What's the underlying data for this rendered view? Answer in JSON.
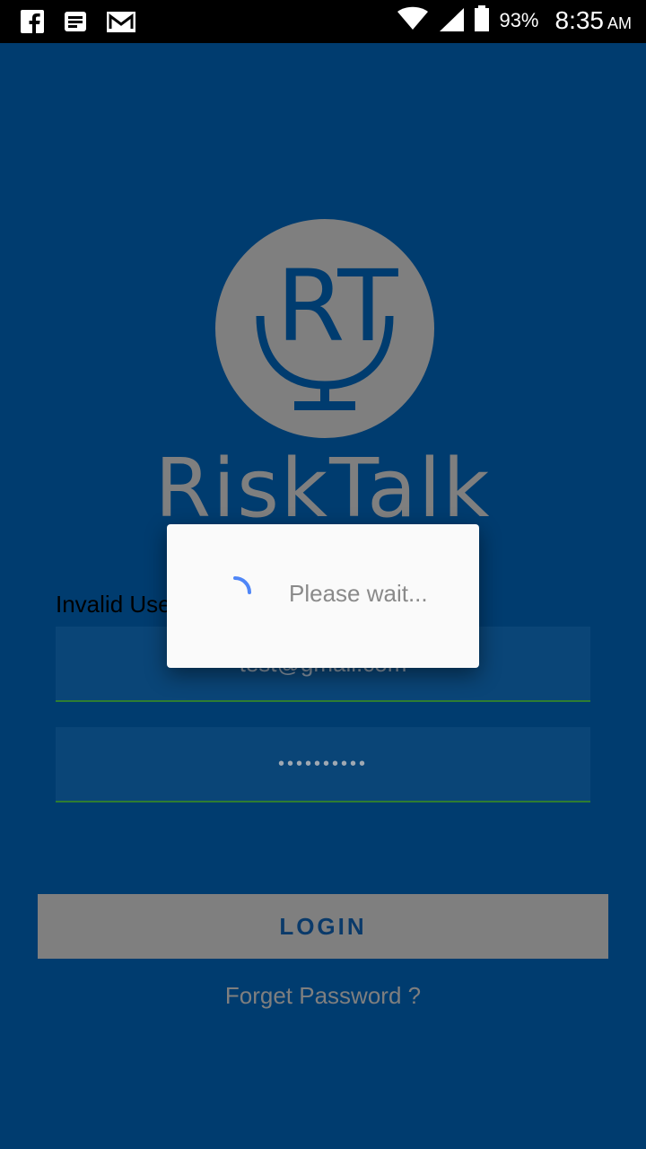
{
  "status_bar": {
    "left_icons": [
      "facebook-icon",
      "news-icon",
      "gmail-icon"
    ],
    "battery": "93%",
    "time": "8:35",
    "ampm": "AM"
  },
  "logo": {
    "monogram": "RT",
    "brand": "RiskTalk"
  },
  "login": {
    "invalid_message": "Invalid User",
    "email_value": "test@gmail.com",
    "password_value": "••••••••••",
    "login_label": "LOGIN",
    "forget_link": "Forget Password ?"
  },
  "dialog": {
    "message": "Please wait..."
  },
  "colors": {
    "background": "#003c6f",
    "button": "#7f7f7f",
    "dialog": "#fafafa",
    "spinner": "#4f86f7",
    "field_underline": "#2e7d32"
  }
}
